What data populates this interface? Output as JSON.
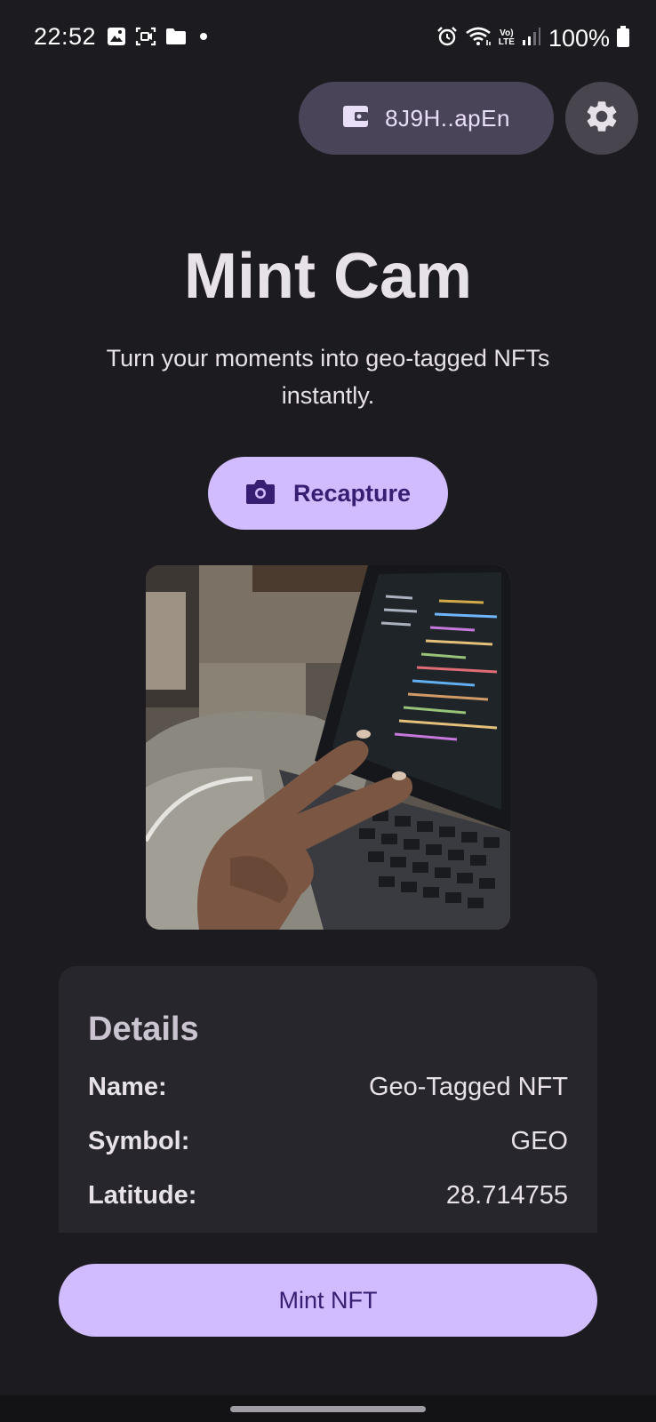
{
  "status_bar": {
    "time": "22:52",
    "battery": "100%",
    "left_icons": [
      "gallery-icon",
      "screen-record-icon",
      "folder-icon",
      "notification-dot-icon"
    ],
    "right_icons": [
      "alarm-icon",
      "wifi-icon",
      "volte-icon",
      "signal-icon",
      "battery-icon"
    ],
    "volte_text": "LTE"
  },
  "wallet": {
    "address": "8J9H..apEn",
    "icon": "wallet-icon"
  },
  "settings": {
    "icon": "gear-icon"
  },
  "hero": {
    "title": "Mint Cam",
    "subtitle": "Turn your moments into geo-tagged NFTs instantly."
  },
  "recapture": {
    "label": "Recapture",
    "icon": "camera-icon"
  },
  "photo": {
    "description_icon": "captured-photo"
  },
  "details": {
    "title": "Details",
    "rows": [
      {
        "label": "Name:",
        "value": "Geo-Tagged NFT"
      },
      {
        "label": "Symbol:",
        "value": "GEO"
      },
      {
        "label": "Latitude:",
        "value": "28.714755"
      }
    ]
  },
  "mint": {
    "label": "Mint NFT"
  },
  "colors": {
    "background": "#1c1b20",
    "primary_container": "#d0bcff",
    "on_primary": "#381e72",
    "chip": "#4a4458",
    "card": "#28262d"
  }
}
